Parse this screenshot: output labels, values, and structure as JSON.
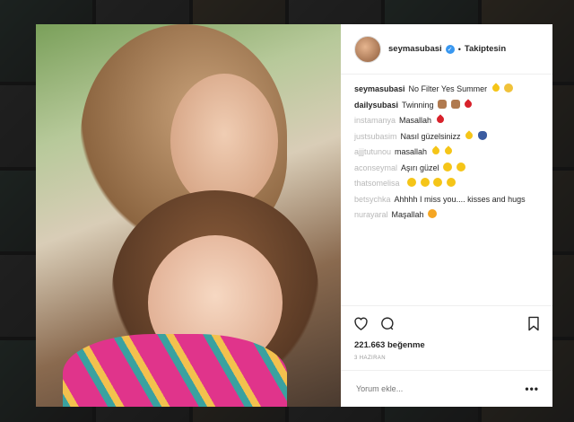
{
  "post": {
    "username": "seymasubasi",
    "follow_label": "Takiptesin",
    "caption": "No Filter Yes Summer",
    "likes": "221.663 beğenme",
    "date": "3 HAZIRAN",
    "add_comment_placeholder": "Yorum ekle...",
    "more_label": "•••"
  },
  "comments": [
    {
      "user": "dailysubasi",
      "text": "Twinning",
      "blur": true
    },
    {
      "user": "instamanya",
      "text": "Masallah",
      "blur": true
    },
    {
      "user": "justsubasim",
      "text": "Nasıl güzelsinizz",
      "blur": true
    },
    {
      "user": "ajjjtutunou",
      "text": "masallah",
      "blur": true
    },
    {
      "user": "aconseymal",
      "text": "Aşırı güzel",
      "blur": true
    },
    {
      "user": "thatsomelisa",
      "text": "",
      "blur": true
    },
    {
      "user": "betsychka",
      "text": "Ahhhh I miss you.... kisses and hugs",
      "blur": true
    },
    {
      "user": "nurayaral",
      "text": "Maşallah",
      "blur": true
    }
  ],
  "icons": {
    "like": "heart-icon",
    "comment": "comment-icon",
    "save": "bookmark-icon",
    "verified": "verified-badge-icon"
  },
  "colors": {
    "verified": "#3897f0",
    "text": "#262626",
    "muted": "#999999"
  }
}
